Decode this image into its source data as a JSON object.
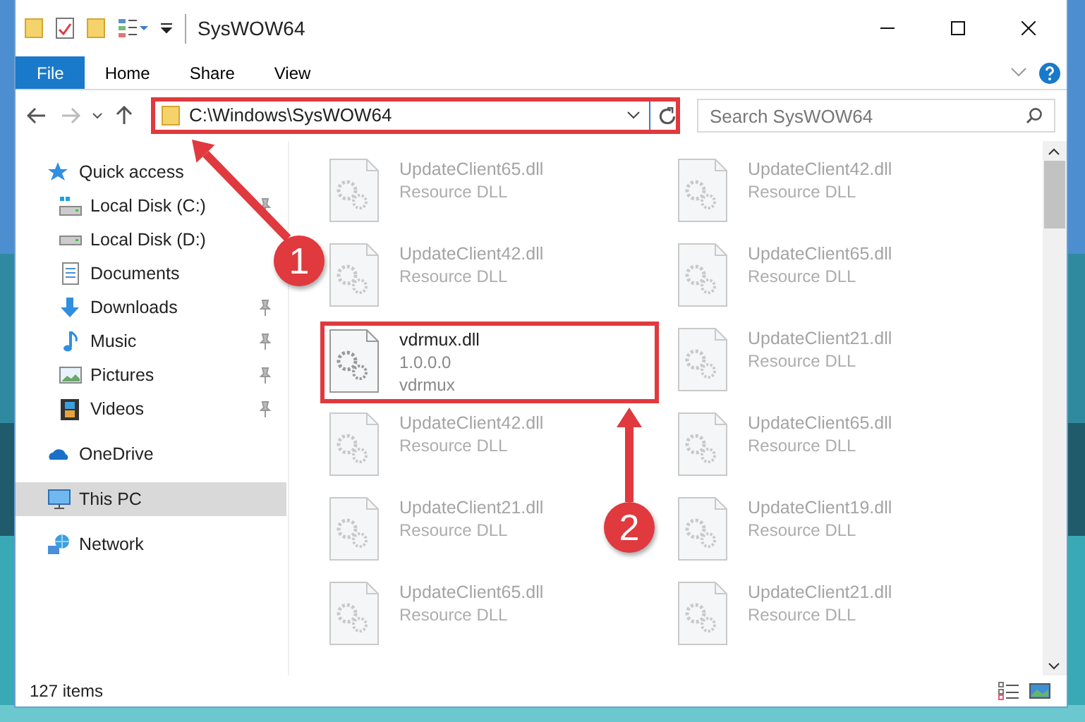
{
  "window": {
    "title": "SysWOW64"
  },
  "ribbon_tabs": [
    {
      "label": "File",
      "kind": "file"
    },
    {
      "label": "Home",
      "kind": "tab"
    },
    {
      "label": "Share",
      "kind": "tab"
    },
    {
      "label": "View",
      "kind": "tab"
    }
  ],
  "address": {
    "path": "C:\\Windows\\SysWOW64",
    "highlighted": true
  },
  "search": {
    "placeholder": "Search SysWOW64"
  },
  "nav": [
    {
      "label": "Quick access",
      "kind": "star",
      "pinned": false,
      "selected": false,
      "children": [
        {
          "label": "Local Disk (C:)",
          "kind": "drive-windows",
          "pinned": true,
          "selected": false
        },
        {
          "label": "Local Disk (D:)",
          "kind": "drive",
          "pinned": false,
          "selected": false
        },
        {
          "label": "Documents",
          "kind": "documents",
          "pinned": false,
          "selected": false
        },
        {
          "label": "Downloads",
          "kind": "downloads",
          "pinned": true,
          "selected": false
        },
        {
          "label": "Music",
          "kind": "music",
          "pinned": true,
          "selected": false
        },
        {
          "label": "Pictures",
          "kind": "pictures",
          "pinned": true,
          "selected": false
        },
        {
          "label": "Videos",
          "kind": "videos",
          "pinned": true,
          "selected": false
        }
      ]
    },
    {
      "label": "OneDrive",
      "kind": "onedrive",
      "pinned": false,
      "selected": false
    },
    {
      "label": "This PC",
      "kind": "pc",
      "pinned": false,
      "selected": true
    },
    {
      "label": "Network",
      "kind": "network",
      "pinned": false,
      "selected": false
    }
  ],
  "files": [
    {
      "name": "UpdateClient65.dll",
      "lines": [
        "Resource DLL"
      ],
      "blurred": true,
      "highlighted": false
    },
    {
      "name": "UpdateClient42.dll",
      "lines": [
        "Resource DLL"
      ],
      "blurred": true,
      "highlighted": false
    },
    {
      "name": "UpdateClient42.dll",
      "lines": [
        "Resource DLL"
      ],
      "blurred": true,
      "highlighted": false
    },
    {
      "name": "UpdateClient65.dll",
      "lines": [
        "Resource DLL"
      ],
      "blurred": true,
      "highlighted": false
    },
    {
      "name": "vdrmux.dll",
      "lines": [
        "1.0.0.0",
        "vdrmux"
      ],
      "blurred": false,
      "highlighted": true
    },
    {
      "name": "UpdateClient21.dll",
      "lines": [
        "Resource DLL"
      ],
      "blurred": true,
      "highlighted": false
    },
    {
      "name": "UpdateClient42.dll",
      "lines": [
        "Resource DLL"
      ],
      "blurred": true,
      "highlighted": false
    },
    {
      "name": "UpdateClient65.dll",
      "lines": [
        "Resource DLL"
      ],
      "blurred": true,
      "highlighted": false
    },
    {
      "name": "UpdateClient21.dll",
      "lines": [
        "Resource DLL"
      ],
      "blurred": true,
      "highlighted": false
    },
    {
      "name": "UpdateClient19.dll",
      "lines": [
        "Resource DLL"
      ],
      "blurred": true,
      "highlighted": false
    },
    {
      "name": "UpdateClient65.dll",
      "lines": [
        "Resource DLL"
      ],
      "blurred": true,
      "highlighted": false
    },
    {
      "name": "UpdateClient21.dll",
      "lines": [
        "Resource DLL"
      ],
      "blurred": true,
      "highlighted": false
    }
  ],
  "status_bar": {
    "item_count": "127 items"
  },
  "annotations": [
    {
      "label": "1"
    },
    {
      "label": "2"
    }
  ]
}
